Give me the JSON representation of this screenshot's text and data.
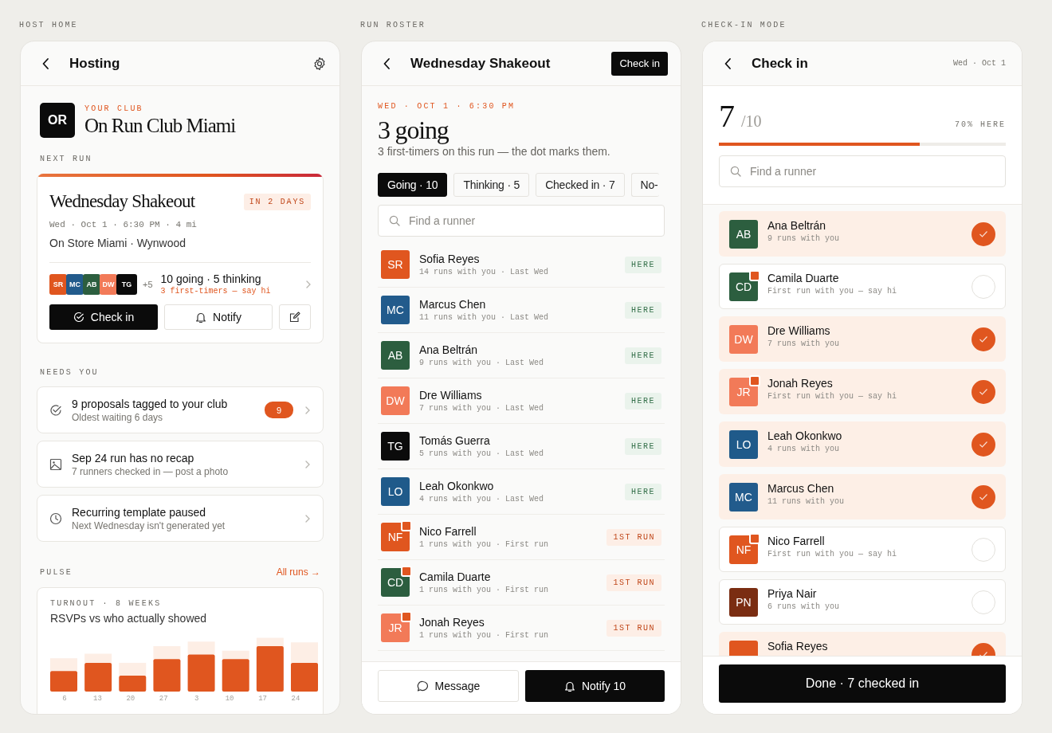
{
  "host_home": {
    "caption": "HOST HOME",
    "header": {
      "title": "Hosting"
    },
    "club": {
      "badge": "OR",
      "eyebrow": "YOUR CLUB",
      "name": "On Run Club Miami"
    },
    "next_run": {
      "section": "NEXT RUN",
      "title": "Wednesday Shakeout",
      "when_badge": "IN 2 DAYS",
      "meta": "Wed · Oct 1 · 6:30 PM · 4 mi",
      "place": "On Store Miami · Wynwood",
      "avatars": [
        {
          "initials": "SR",
          "color": "#e0561f"
        },
        {
          "initials": "MC",
          "color": "#225b8c"
        },
        {
          "initials": "AB",
          "color": "#2c5e3f"
        },
        {
          "initials": "DW",
          "color": "#f27a58"
        },
        {
          "initials": "TG",
          "color": "#0b0b0b"
        }
      ],
      "more": "+5",
      "summary": "10 going · 5 thinking",
      "note": "3 first-timers — say hi",
      "check_in": "Check in",
      "notify": "Notify"
    },
    "needs_you": {
      "section": "NEEDS YOU",
      "items": [
        {
          "kind": "proposals",
          "title": "9 proposals tagged to your club",
          "subtitle": "Oldest waiting 6 days",
          "count": "9"
        },
        {
          "kind": "recap",
          "title": "Sep 24 run has no recap",
          "subtitle": "7 runners checked in — post a photo"
        },
        {
          "kind": "template",
          "title": "Recurring template paused",
          "subtitle": "Next Wednesday isn't generated yet"
        }
      ]
    },
    "pulse": {
      "section": "PULSE",
      "link": "All runs →",
      "eyebrow": "TURNOUT · 8 WEEKS",
      "title": "RSVPs vs who actually showed",
      "week_labels": [
        "6",
        "13",
        "20",
        "27",
        "3",
        "10",
        "17",
        "24"
      ]
    }
  },
  "run_roster": {
    "caption": "RUN ROSTER",
    "header": {
      "title": "Wednesday Shakeout",
      "action": "Check in"
    },
    "eyebrow": "WED · OCT 1 · 6:30 PM",
    "headline": "3 going",
    "subtitle": "3 first-timers on this run — the dot marks them.",
    "tabs": [
      {
        "label": "Going · 10",
        "selected": true
      },
      {
        "label": "Thinking · 5",
        "selected": false
      },
      {
        "label": "Checked in · 7",
        "selected": false
      },
      {
        "label": "No-",
        "selected": false
      }
    ],
    "search": {
      "placeholder": "Find a runner"
    },
    "runners": [
      {
        "initials": "SR",
        "color": "#e0561f",
        "first_timer": false,
        "name": "Sofia Reyes",
        "detail": "14 runs with you · Last Wed",
        "tag": "HERE",
        "kind": "here"
      },
      {
        "initials": "MC",
        "color": "#225b8c",
        "first_timer": false,
        "name": "Marcus Chen",
        "detail": "11 runs with you · Last Wed",
        "tag": "HERE",
        "kind": "here"
      },
      {
        "initials": "AB",
        "color": "#2c5e3f",
        "first_timer": false,
        "name": "Ana Beltrán",
        "detail": "9 runs with you · Last Wed",
        "tag": "HERE",
        "kind": "here"
      },
      {
        "initials": "DW",
        "color": "#f27a58",
        "first_timer": false,
        "name": "Dre Williams",
        "detail": "7 runs with you · Last Wed",
        "tag": "HERE",
        "kind": "here"
      },
      {
        "initials": "TG",
        "color": "#0b0b0b",
        "first_timer": false,
        "name": "Tomás Guerra",
        "detail": "5 runs with you · Last Wed",
        "tag": "HERE",
        "kind": "here"
      },
      {
        "initials": "LO",
        "color": "#1f5a8a",
        "first_timer": false,
        "name": "Leah Okonkwo",
        "detail": "4 runs with you · Last Wed",
        "tag": "HERE",
        "kind": "here"
      },
      {
        "initials": "NF",
        "color": "#e0561f",
        "first_timer": true,
        "name": "Nico Farrell",
        "detail": "1 runs with you · First run",
        "tag": "1ST RUN",
        "kind": "first"
      },
      {
        "initials": "CD",
        "color": "#2c5e3f",
        "first_timer": true,
        "name": "Camila Duarte",
        "detail": "1 runs with you · First run",
        "tag": "1ST RUN",
        "kind": "first"
      },
      {
        "initials": "JR",
        "color": "#f27a58",
        "first_timer": true,
        "name": "Jonah Reyes",
        "detail": "1 runs with you · First run",
        "tag": "1ST RUN",
        "kind": "first"
      }
    ],
    "message": "Message",
    "notify": "Notify 10"
  },
  "check_in_mode": {
    "caption": "CHECK-IN MODE",
    "header": {
      "title": "Check in",
      "date": "Wed · Oct 1"
    },
    "count": "7",
    "total": "/10",
    "percent": "70% HERE",
    "progress": {
      "level": 0.7
    },
    "search": {
      "placeholder": "Find a runner"
    },
    "runners": [
      {
        "initials": "AB",
        "color": "#2c5e3f",
        "first_timer": false,
        "name": "Ana Beltrán",
        "detail": "9 runs with you",
        "checked": true
      },
      {
        "initials": "CD",
        "color": "#2c5e3f",
        "first_timer": true,
        "name": "Camila Duarte",
        "detail": "First run with you — say hi",
        "checked": false
      },
      {
        "initials": "DW",
        "color": "#f27a58",
        "first_timer": false,
        "name": "Dre Williams",
        "detail": "7 runs with you",
        "checked": true
      },
      {
        "initials": "JR",
        "color": "#f27a58",
        "first_timer": true,
        "name": "Jonah Reyes",
        "detail": "First run with you — say hi",
        "checked": true
      },
      {
        "initials": "LO",
        "color": "#1f5a8a",
        "first_timer": false,
        "name": "Leah Okonkwo",
        "detail": "4 runs with you",
        "checked": true
      },
      {
        "initials": "MC",
        "color": "#225b8c",
        "first_timer": false,
        "name": "Marcus Chen",
        "detail": "11 runs with you",
        "checked": true
      },
      {
        "initials": "NF",
        "color": "#e0561f",
        "first_timer": true,
        "name": "Nico Farrell",
        "detail": "First run with you — say hi",
        "checked": false
      },
      {
        "initials": "PN",
        "color": "#7a2d12",
        "first_timer": false,
        "name": "Priya Nair",
        "detail": "6 runs with you",
        "checked": false
      },
      {
        "color": "#e0561f",
        "first_timer": false,
        "name": "Sofia Reyes",
        "checked": true
      }
    ],
    "done": "Done · 7 checked in"
  }
}
